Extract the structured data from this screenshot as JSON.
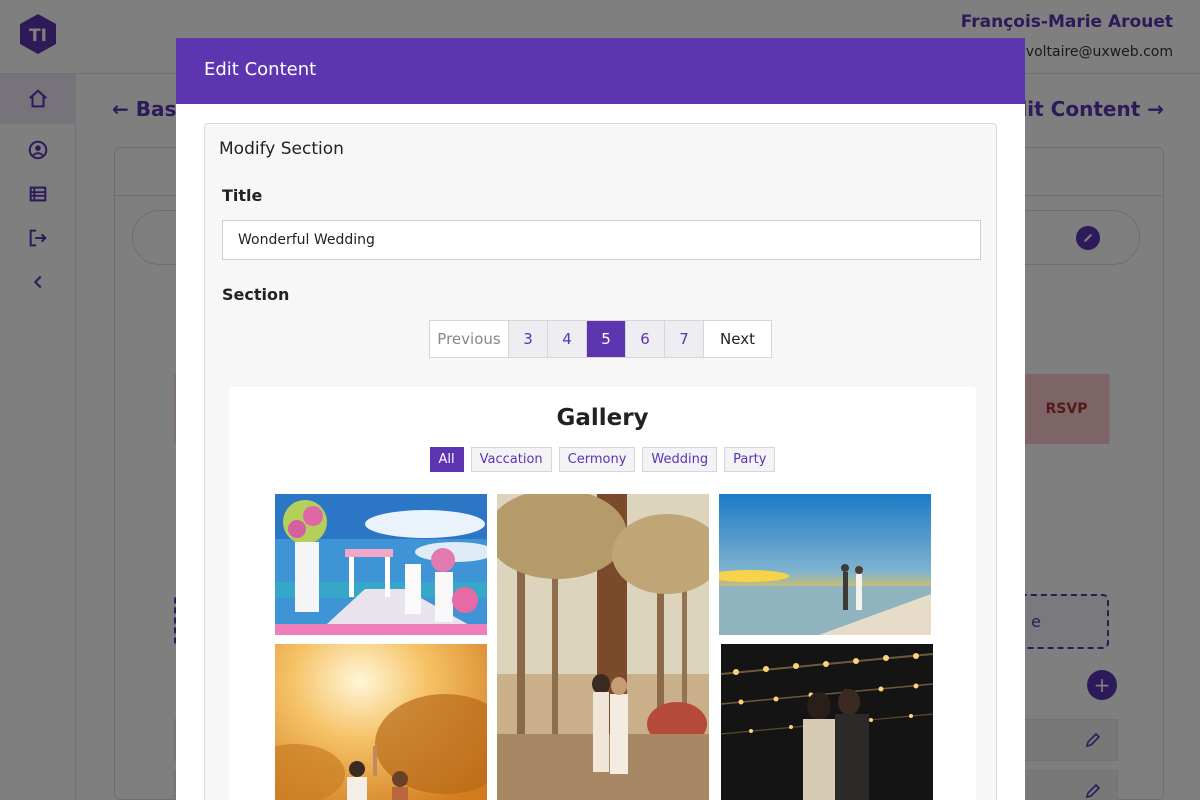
{
  "app": {
    "user_name": "François-Marie Arouet",
    "user_email": "voltaire@uxweb.com"
  },
  "background": {
    "back_label": "← Bas",
    "next_label": "Edit Content →",
    "rsvp_label": "RSVP",
    "dashed_label": "e",
    "plus_label": "+"
  },
  "modal": {
    "header": "Edit Content",
    "section_heading": "Modify Section",
    "title_label": "Title",
    "title_value": "Wonderful Wedding",
    "section_label": "Section",
    "pagination": {
      "previous": "Previous",
      "pages": [
        "3",
        "4",
        "5",
        "6",
        "7"
      ],
      "active_page": "5",
      "next": "Next"
    }
  },
  "gallery": {
    "title": "Gallery",
    "filters": [
      "All",
      "Vaccation",
      "Cermony",
      "Wedding",
      "Party"
    ],
    "active_filter": "All",
    "photos": [
      "wedding-aisle",
      "couple-forest",
      "beach-sunset",
      "sunset-dance",
      "night-lights"
    ]
  },
  "colors": {
    "accent": "#5e35b1",
    "overlay": "rgba(0,0,0,0.5)"
  }
}
